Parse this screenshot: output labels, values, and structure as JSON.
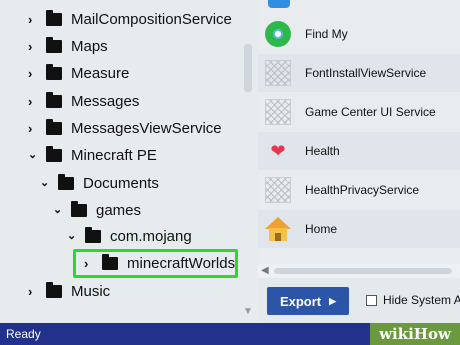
{
  "tree": {
    "items": [
      {
        "label": "MailCompositionService"
      },
      {
        "label": "Maps"
      },
      {
        "label": "Measure"
      },
      {
        "label": "Messages"
      },
      {
        "label": "MessagesViewService"
      },
      {
        "label": "Minecraft PE"
      },
      {
        "label": "Documents"
      },
      {
        "label": "games"
      },
      {
        "label": "com.mojang"
      },
      {
        "label": "minecraftWorlds"
      },
      {
        "label": "Music"
      }
    ]
  },
  "apps": {
    "items": [
      {
        "label": "Find My",
        "icon": "find-my-icon"
      },
      {
        "label": "FontInstallViewService",
        "icon": "placeholder-app-icon"
      },
      {
        "label": "Game Center UI Service",
        "icon": "placeholder-app-icon"
      },
      {
        "label": "Health",
        "icon": "heart-icon"
      },
      {
        "label": "HealthPrivacyService",
        "icon": "placeholder-app-icon"
      },
      {
        "label": "Home",
        "icon": "home-icon"
      }
    ]
  },
  "controls": {
    "export_label": "Export",
    "hide_label": "Hide System A"
  },
  "status": {
    "text": "Ready"
  },
  "watermark": {
    "text": "wikiHow"
  },
  "colors": {
    "accent": "#2c55a8",
    "status_bar": "#22318c",
    "highlight": "#31d62c",
    "watermark": "#6b9a3e"
  }
}
